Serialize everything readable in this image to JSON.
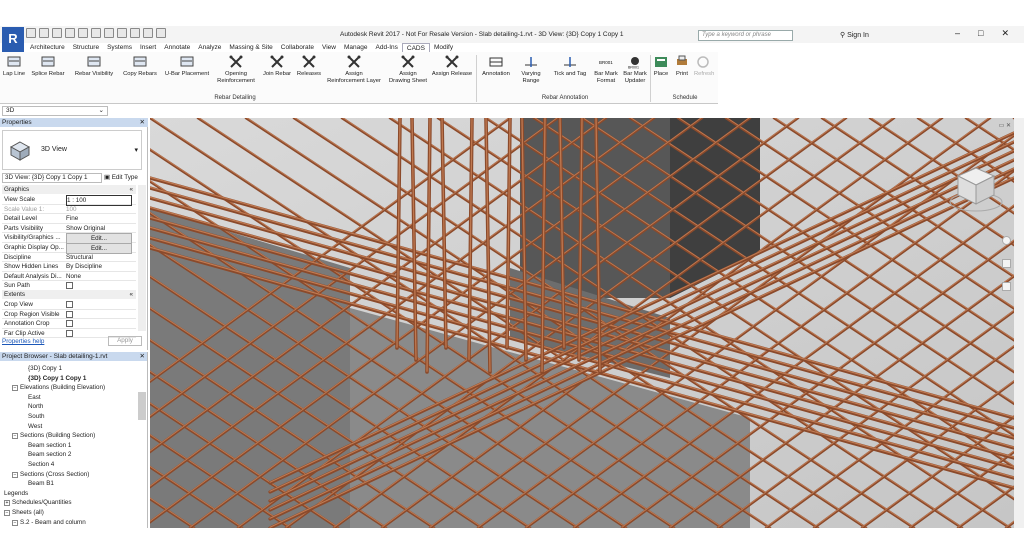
{
  "app": {
    "menu_letter": "R",
    "title": "Autodesk Revit 2017 - Not For Resale Version -   Slab detailing-1.rvt - 3D View: {3D} Copy 1 Copy 1",
    "search_placeholder": "Type a keyword or phrase",
    "sign_in": "Sign In",
    "win_min": "–",
    "win_max": "□",
    "win_close": "✕"
  },
  "tabs": [
    "Architecture",
    "Structure",
    "Systems",
    "Insert",
    "Annotate",
    "Analyze",
    "Massing & Site",
    "Collaborate",
    "View",
    "Manage",
    "Add-Ins",
    "CADS",
    "Modify"
  ],
  "active_tab": "CADS",
  "ribbon": {
    "panels": [
      {
        "label": "Rebar Detailing"
      },
      {
        "label": "Rebar Annotation"
      },
      {
        "label": "Schedule"
      }
    ],
    "buttons": [
      {
        "id": "lap-line",
        "label": "Lap Line"
      },
      {
        "id": "splice-rebar",
        "label": "Splice Rebar"
      },
      {
        "id": "rebar-visibility",
        "label": "Rebar Visibility"
      },
      {
        "id": "copy-rebars",
        "label": "Copy Rebars"
      },
      {
        "id": "u-bar-placement",
        "label": "U-Bar Placement"
      },
      {
        "id": "opening-reinforcement",
        "label": "Opening\nReinforcement"
      },
      {
        "id": "join-rebar",
        "label": "Join Rebar"
      },
      {
        "id": "releases",
        "label": "Releases"
      },
      {
        "id": "assign-reinforcement-layer",
        "label": "Assign\nReinforcement Layer"
      },
      {
        "id": "assign-drawing-sheet",
        "label": "Assign\nDrawing Sheet"
      },
      {
        "id": "assign-release",
        "label": "Assign Release"
      },
      {
        "id": "annotation",
        "label": "Annotation"
      },
      {
        "id": "varying-range",
        "label": "Varying\nRange"
      },
      {
        "id": "tick-and-tag",
        "label": "Tick and Tag"
      },
      {
        "id": "bar-mark-format",
        "label": "Bar Mark\nFormat"
      },
      {
        "id": "bar-mark-updater",
        "label": "Bar Mark\nUpdater"
      },
      {
        "id": "place",
        "label": "Place"
      },
      {
        "id": "print",
        "label": "Print"
      },
      {
        "id": "refresh",
        "label": "Refresh"
      }
    ],
    "br_icon_text_1": "BR001",
    "br_icon_text_2": "BR001"
  },
  "view_selector": "3D",
  "properties": {
    "header": "Properties",
    "type_name": "3D View",
    "instance_selector": "3D View: {3D} Copy 1 Copy 1",
    "edit_type": "Edit Type",
    "groups": {
      "graphics": "Graphics",
      "extents": "Extents"
    },
    "rows": [
      {
        "k": "View Scale",
        "v": "1 : 100"
      },
      {
        "k": "Scale Value    1:",
        "v": "100"
      },
      {
        "k": "Detail Level",
        "v": "Fine"
      },
      {
        "k": "Parts Visibility",
        "v": "Show Original"
      },
      {
        "k": "Visibility/Graphics ...",
        "v": "Edit..."
      },
      {
        "k": "Graphic Display Op...",
        "v": "Edit..."
      },
      {
        "k": "Discipline",
        "v": "Structural"
      },
      {
        "k": "Show Hidden Lines",
        "v": "By Discipline"
      },
      {
        "k": "Default Analysis Di...",
        "v": "None"
      },
      {
        "k": "Sun Path",
        "v": ""
      }
    ],
    "extent_rows": [
      {
        "k": "Crop View"
      },
      {
        "k": "Crop Region Visible"
      },
      {
        "k": "Annotation Crop"
      },
      {
        "k": "Far Clip Active"
      }
    ],
    "help_link": "Properties help",
    "apply": "Apply"
  },
  "project_browser": {
    "header": "Project Browser - Slab detailing-1.rvt",
    "items": [
      {
        "label": "{3D} Copy 1",
        "level": 3,
        "bold": false
      },
      {
        "label": "{3D} Copy 1 Copy 1",
        "level": 3,
        "bold": true
      },
      {
        "label": "Elevations (Building Elevation)",
        "level": 1,
        "bold": false,
        "toggle": "−"
      },
      {
        "label": "East",
        "level": 3,
        "bold": false
      },
      {
        "label": "North",
        "level": 3,
        "bold": false
      },
      {
        "label": "South",
        "level": 3,
        "bold": false
      },
      {
        "label": "West",
        "level": 3,
        "bold": false
      },
      {
        "label": "Sections (Building Section)",
        "level": 1,
        "bold": false,
        "toggle": "−"
      },
      {
        "label": "Beam section 1",
        "level": 3,
        "bold": false
      },
      {
        "label": "Beam section 2",
        "level": 3,
        "bold": false
      },
      {
        "label": "Section 4",
        "level": 3,
        "bold": false
      },
      {
        "label": "Sections (Cross Section)",
        "level": 1,
        "bold": false,
        "toggle": "−"
      },
      {
        "label": "Beam B1",
        "level": 3,
        "bold": false
      },
      {
        "label": "Legends",
        "level": 0,
        "bold": false
      },
      {
        "label": "Schedules/Quantities",
        "level": 0,
        "bold": false,
        "toggle": "+"
      },
      {
        "label": "Sheets (all)",
        "level": 0,
        "bold": false,
        "toggle": "−"
      },
      {
        "label": "S.2 - Beam and column",
        "level": 1,
        "bold": false,
        "toggle": "−"
      }
    ]
  },
  "colors": {
    "rebar": "#8b4a2b",
    "rebar_light": "#c07a52",
    "concrete": "#6a6a6a",
    "viewport_bg": "#d2d2d2",
    "panel_header": "#c9d9ee",
    "app_blue": "#2a5cb0"
  },
  "icons": [
    "search-icon",
    "view-cube",
    "navigation-wheel",
    "close-icon"
  ]
}
